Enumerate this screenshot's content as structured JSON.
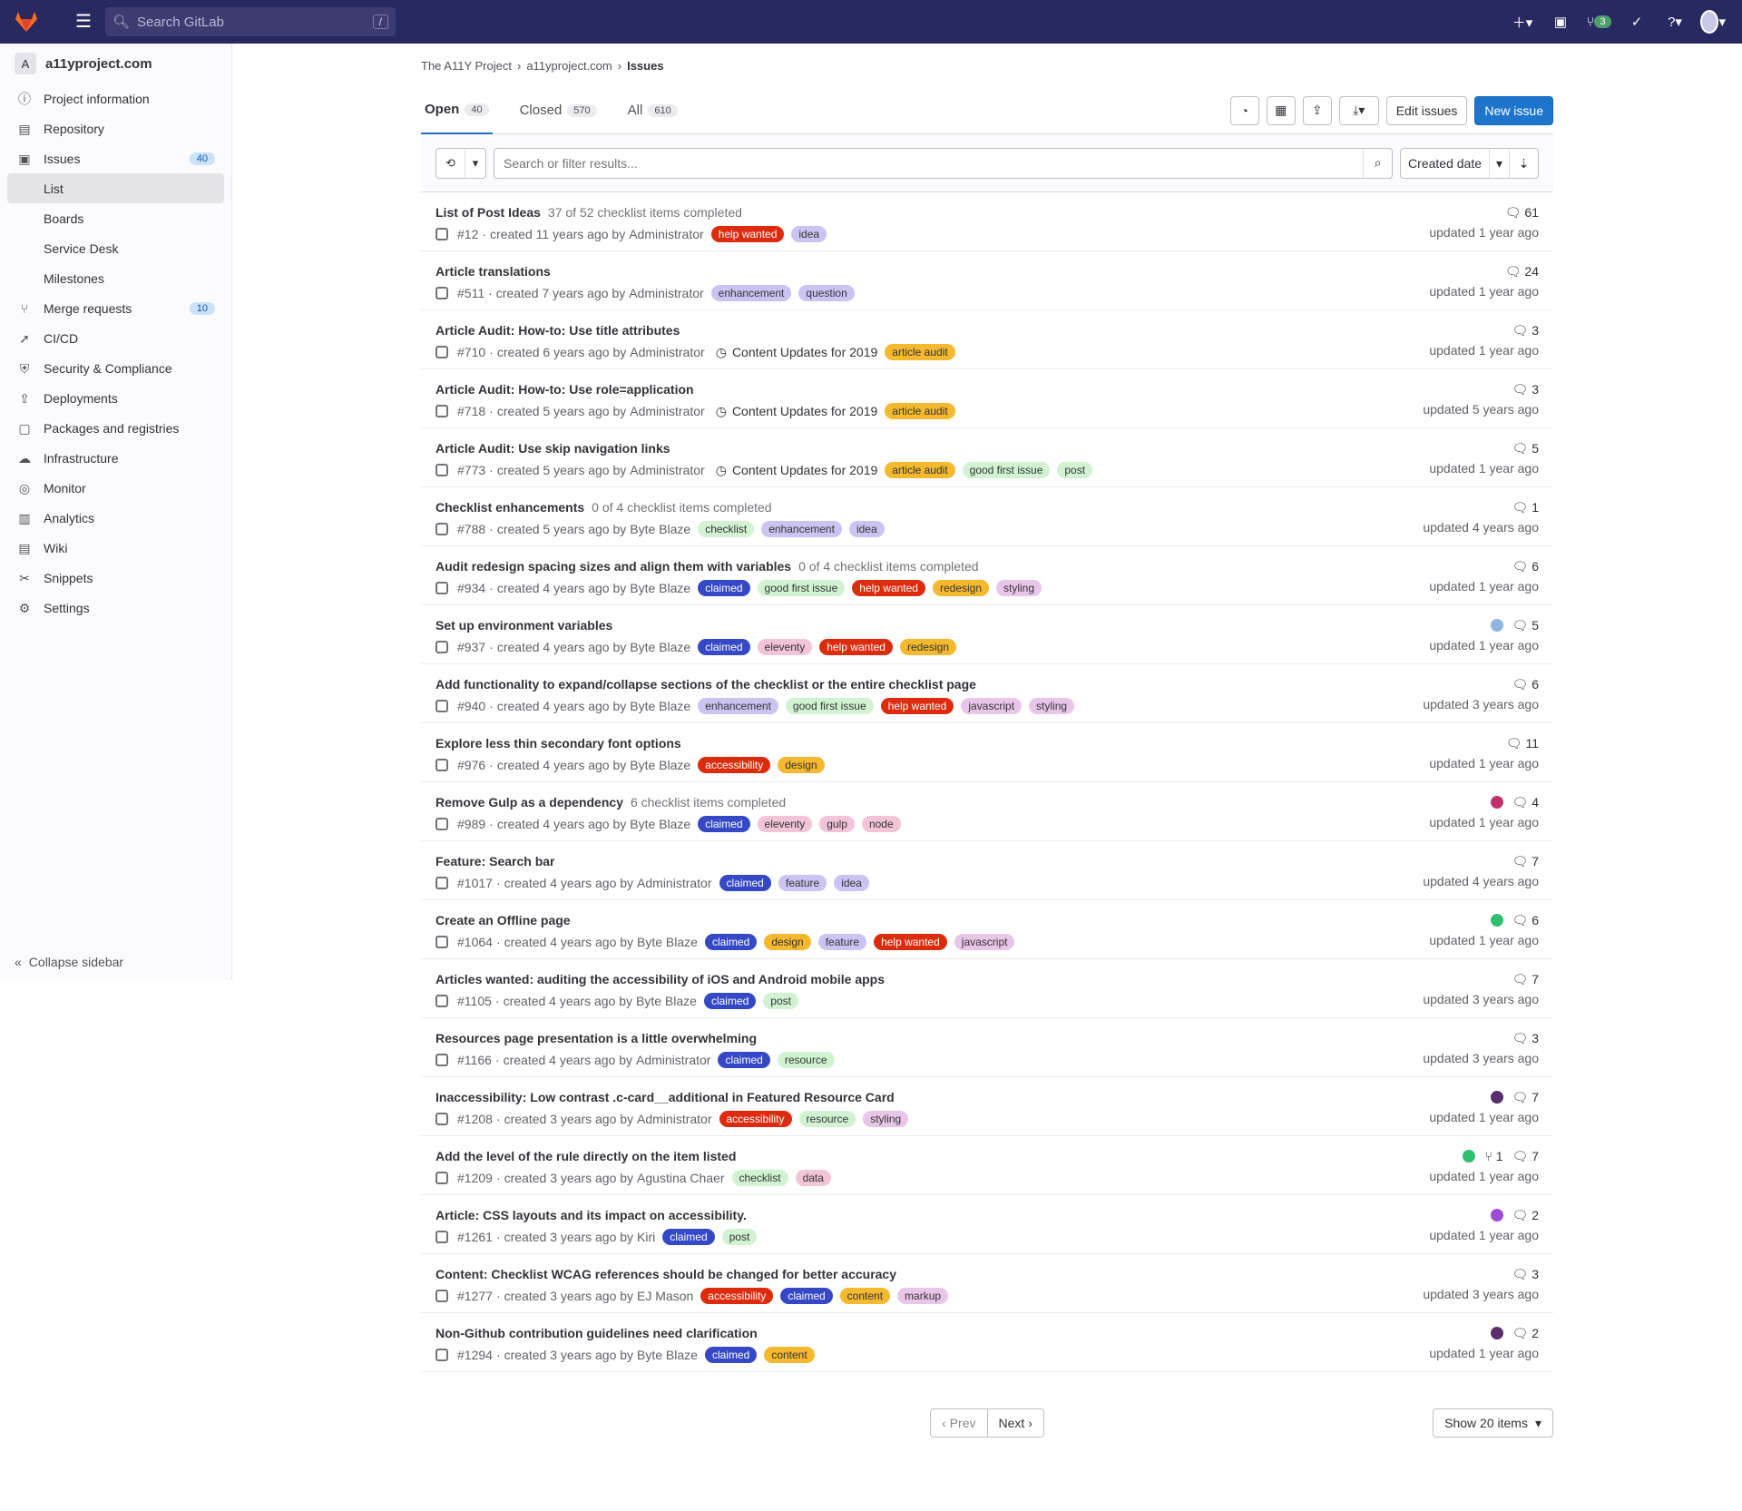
{
  "topbar": {
    "search_placeholder": "Search GitLab",
    "search_shortcut": "/",
    "mr_count": "3"
  },
  "sidebar": {
    "project_initial": "A",
    "project_name": "a11yproject.com",
    "items": [
      {
        "label": "Project information",
        "icon": "info-icon"
      },
      {
        "label": "Repository",
        "icon": "book-icon"
      },
      {
        "label": "Issues",
        "icon": "issues-icon",
        "count": "40"
      },
      {
        "label": "Merge requests",
        "icon": "merge-icon",
        "count": "10"
      },
      {
        "label": "CI/CD",
        "icon": "rocket-icon"
      },
      {
        "label": "Security & Compliance",
        "icon": "shield-icon"
      },
      {
        "label": "Deployments",
        "icon": "deploy-icon"
      },
      {
        "label": "Packages and registries",
        "icon": "package-icon"
      },
      {
        "label": "Infrastructure",
        "icon": "cloud-icon"
      },
      {
        "label": "Monitor",
        "icon": "monitor-icon"
      },
      {
        "label": "Analytics",
        "icon": "chart-icon"
      },
      {
        "label": "Wiki",
        "icon": "wiki-icon"
      },
      {
        "label": "Snippets",
        "icon": "snippet-icon"
      },
      {
        "label": "Settings",
        "icon": "gear-icon"
      }
    ],
    "issue_subitems": [
      "List",
      "Boards",
      "Service Desk",
      "Milestones"
    ],
    "collapse_label": "Collapse sidebar"
  },
  "breadcrumb": [
    "The A11Y Project",
    "a11yproject.com",
    "Issues"
  ],
  "tabs": [
    {
      "label": "Open",
      "count": "40"
    },
    {
      "label": "Closed",
      "count": "570"
    },
    {
      "label": "All",
      "count": "610"
    }
  ],
  "actions": {
    "edit_issues": "Edit issues",
    "new_issue": "New issue"
  },
  "filter": {
    "placeholder": "Search or filter results...",
    "sort_label": "Created date"
  },
  "issues": [
    {
      "title": "List of Post Ideas",
      "tasks": "37 of 52 checklist items completed",
      "num": "#12",
      "created": "created 11 years ago by",
      "author": "Administrator",
      "milestone": "",
      "labels": [
        {
          "t": "help wanted",
          "bg": "#dd2b0e",
          "fg": "#fff"
        },
        {
          "t": "idea",
          "bg": "#cbc3f2",
          "fg": "#333"
        }
      ],
      "comments": "61",
      "updated": "updated 1 year ago"
    },
    {
      "title": "Article translations",
      "tasks": "",
      "num": "#511",
      "created": "created 7 years ago by",
      "author": "Administrator",
      "milestone": "",
      "labels": [
        {
          "t": "enhancement",
          "bg": "#cbc3f2",
          "fg": "#333"
        },
        {
          "t": "question",
          "bg": "#cbc3f2",
          "fg": "#333"
        }
      ],
      "comments": "24",
      "updated": "updated 1 year ago"
    },
    {
      "title": "Article Audit: How-to: Use title attributes",
      "tasks": "",
      "num": "#710",
      "created": "created 6 years ago by",
      "author": "Administrator",
      "milestone": "Content Updates for 2019",
      "labels": [
        {
          "t": "article audit",
          "bg": "#f5b92f",
          "fg": "#333"
        }
      ],
      "comments": "3",
      "updated": "updated 1 year ago"
    },
    {
      "title": "Article Audit: How-to: Use role=application",
      "tasks": "",
      "num": "#718",
      "created": "created 5 years ago by",
      "author": "Administrator",
      "milestone": "Content Updates for 2019",
      "labels": [
        {
          "t": "article audit",
          "bg": "#f5b92f",
          "fg": "#333"
        }
      ],
      "comments": "3",
      "updated": "updated 5 years ago"
    },
    {
      "title": "Article Audit: Use skip navigation links",
      "tasks": "",
      "num": "#773",
      "created": "created 5 years ago by",
      "author": "Administrator",
      "milestone": "Content Updates for 2019",
      "labels": [
        {
          "t": "article audit",
          "bg": "#f5b92f",
          "fg": "#333"
        },
        {
          "t": "good first issue",
          "bg": "#d1f3d1",
          "fg": "#333"
        },
        {
          "t": "post",
          "bg": "#d1f3d1",
          "fg": "#333"
        }
      ],
      "comments": "5",
      "updated": "updated 1 year ago"
    },
    {
      "title": "Checklist enhancements",
      "tasks": "0 of 4 checklist items completed",
      "num": "#788",
      "created": "created 5 years ago by",
      "author": "Byte Blaze",
      "milestone": "",
      "labels": [
        {
          "t": "checklist",
          "bg": "#d1f3d1",
          "fg": "#333"
        },
        {
          "t": "enhancement",
          "bg": "#cbc3f2",
          "fg": "#333"
        },
        {
          "t": "idea",
          "bg": "#cbc3f2",
          "fg": "#333"
        }
      ],
      "comments": "1",
      "updated": "updated 4 years ago"
    },
    {
      "title": "Audit redesign spacing sizes and align them with variables",
      "tasks": "0 of 4 checklist items completed",
      "num": "#934",
      "created": "created 4 years ago by",
      "author": "Byte Blaze",
      "milestone": "",
      "labels": [
        {
          "t": "claimed",
          "bg": "#3548c6",
          "fg": "#fff"
        },
        {
          "t": "good first issue",
          "bg": "#d1f3d1",
          "fg": "#333"
        },
        {
          "t": "help wanted",
          "bg": "#dd2b0e",
          "fg": "#fff"
        },
        {
          "t": "redesign",
          "bg": "#f5b92f",
          "fg": "#333"
        },
        {
          "t": "styling",
          "bg": "#e9c6e9",
          "fg": "#333"
        }
      ],
      "comments": "6",
      "updated": "updated 1 year ago"
    },
    {
      "title": "Set up environment variables",
      "tasks": "",
      "num": "#937",
      "created": "created 4 years ago by",
      "author": "Byte Blaze",
      "milestone": "",
      "labels": [
        {
          "t": "claimed",
          "bg": "#3548c6",
          "fg": "#fff"
        },
        {
          "t": "eleventy",
          "bg": "#f2c4d8",
          "fg": "#333"
        },
        {
          "t": "help wanted",
          "bg": "#dd2b0e",
          "fg": "#fff"
        },
        {
          "t": "redesign",
          "bg": "#f5b92f",
          "fg": "#333"
        }
      ],
      "comments": "5",
      "updated": "updated 1 year ago",
      "avatar": "#8fb4e0"
    },
    {
      "title": "Add functionality to expand/collapse sections of the checklist or the entire checklist page",
      "tasks": "",
      "num": "#940",
      "created": "created 4 years ago by",
      "author": "Byte Blaze",
      "milestone": "",
      "labels": [
        {
          "t": "enhancement",
          "bg": "#cbc3f2",
          "fg": "#333"
        },
        {
          "t": "good first issue",
          "bg": "#d1f3d1",
          "fg": "#333"
        },
        {
          "t": "help wanted",
          "bg": "#dd2b0e",
          "fg": "#fff"
        },
        {
          "t": "javascript",
          "bg": "#e9c6e9",
          "fg": "#333"
        },
        {
          "t": "styling",
          "bg": "#e9c6e9",
          "fg": "#333"
        }
      ],
      "comments": "6",
      "updated": "updated 3 years ago"
    },
    {
      "title": "Explore less thin secondary font options",
      "tasks": "",
      "num": "#976",
      "created": "created 4 years ago by",
      "author": "Byte Blaze",
      "milestone": "",
      "labels": [
        {
          "t": "accessibility",
          "bg": "#dd2b0e",
          "fg": "#fff"
        },
        {
          "t": "design",
          "bg": "#f5b92f",
          "fg": "#333"
        }
      ],
      "comments": "11",
      "updated": "updated 1 year ago"
    },
    {
      "title": "Remove Gulp as a dependency",
      "tasks": "6 checklist items completed",
      "num": "#989",
      "created": "created 4 years ago by",
      "author": "Byte Blaze",
      "milestone": "",
      "labels": [
        {
          "t": "claimed",
          "bg": "#3548c6",
          "fg": "#fff"
        },
        {
          "t": "eleventy",
          "bg": "#f2c4d8",
          "fg": "#333"
        },
        {
          "t": "gulp",
          "bg": "#f2c4d8",
          "fg": "#333"
        },
        {
          "t": "node",
          "bg": "#f2c4d8",
          "fg": "#333"
        }
      ],
      "comments": "4",
      "updated": "updated 1 year ago",
      "avatar": "#c0306a"
    },
    {
      "title": "Feature: Search bar",
      "tasks": "",
      "num": "#1017",
      "created": "created 4 years ago by",
      "author": "Administrator",
      "milestone": "",
      "labels": [
        {
          "t": "claimed",
          "bg": "#3548c6",
          "fg": "#fff"
        },
        {
          "t": "feature",
          "bg": "#cbc3f2",
          "fg": "#333"
        },
        {
          "t": "idea",
          "bg": "#cbc3f2",
          "fg": "#333"
        }
      ],
      "comments": "7",
      "updated": "updated 4 years ago"
    },
    {
      "title": "Create an Offline page",
      "tasks": "",
      "num": "#1064",
      "created": "created 4 years ago by",
      "author": "Byte Blaze",
      "milestone": "",
      "labels": [
        {
          "t": "claimed",
          "bg": "#3548c6",
          "fg": "#fff"
        },
        {
          "t": "design",
          "bg": "#f5b92f",
          "fg": "#333"
        },
        {
          "t": "feature",
          "bg": "#cbc3f2",
          "fg": "#333"
        },
        {
          "t": "help wanted",
          "bg": "#dd2b0e",
          "fg": "#fff"
        },
        {
          "t": "javascript",
          "bg": "#e9c6e9",
          "fg": "#333"
        }
      ],
      "comments": "6",
      "updated": "updated 1 year ago",
      "avatar": "#2fbf71"
    },
    {
      "title": "Articles wanted: auditing the accessibility of iOS and Android mobile apps",
      "tasks": "",
      "num": "#1105",
      "created": "created 4 years ago by",
      "author": "Byte Blaze",
      "milestone": "",
      "labels": [
        {
          "t": "claimed",
          "bg": "#3548c6",
          "fg": "#fff"
        },
        {
          "t": "post",
          "bg": "#d1f3d1",
          "fg": "#333"
        }
      ],
      "comments": "7",
      "updated": "updated 3 years ago"
    },
    {
      "title": "Resources page presentation is a little overwhelming",
      "tasks": "",
      "num": "#1166",
      "created": "created 4 years ago by",
      "author": "Administrator",
      "milestone": "",
      "labels": [
        {
          "t": "claimed",
          "bg": "#3548c6",
          "fg": "#fff"
        },
        {
          "t": "resource",
          "bg": "#d1f3d1",
          "fg": "#333"
        }
      ],
      "comments": "3",
      "updated": "updated 3 years ago"
    },
    {
      "title": "Inaccessibility: Low contrast .c-card__additional in Featured Resource Card",
      "tasks": "",
      "num": "#1208",
      "created": "created 3 years ago by",
      "author": "Administrator",
      "milestone": "",
      "labels": [
        {
          "t": "accessibility",
          "bg": "#dd2b0e",
          "fg": "#fff"
        },
        {
          "t": "resource",
          "bg": "#d1f3d1",
          "fg": "#333"
        },
        {
          "t": "styling",
          "bg": "#e9c6e9",
          "fg": "#333"
        }
      ],
      "comments": "7",
      "updated": "updated 1 year ago",
      "avatar": "#5a2d6e"
    },
    {
      "title": "Add the level of the rule directly on the item listed",
      "tasks": "",
      "num": "#1209",
      "created": "created 3 years ago by",
      "author": "Agustina Chaer",
      "milestone": "",
      "labels": [
        {
          "t": "checklist",
          "bg": "#d1f3d1",
          "fg": "#333"
        },
        {
          "t": "data",
          "bg": "#f2c4d8",
          "fg": "#333"
        }
      ],
      "comments": "7",
      "mrs": "1",
      "updated": "updated 1 year ago",
      "avatar": "#2fbf71"
    },
    {
      "title": "Article: CSS layouts and its impact on accessibility.",
      "tasks": "",
      "num": "#1261",
      "created": "created 3 years ago by",
      "author": "Kiri",
      "milestone": "",
      "labels": [
        {
          "t": "claimed",
          "bg": "#3548c6",
          "fg": "#fff"
        },
        {
          "t": "post",
          "bg": "#d1f3d1",
          "fg": "#333"
        }
      ],
      "comments": "2",
      "updated": "updated 1 year ago",
      "avatar": "#a04ad8"
    },
    {
      "title": "Content: Checklist WCAG references should be changed for better accuracy",
      "tasks": "",
      "num": "#1277",
      "created": "created 3 years ago by",
      "author": "EJ Mason",
      "milestone": "",
      "labels": [
        {
          "t": "accessibility",
          "bg": "#dd2b0e",
          "fg": "#fff"
        },
        {
          "t": "claimed",
          "bg": "#3548c6",
          "fg": "#fff"
        },
        {
          "t": "content",
          "bg": "#f5b92f",
          "fg": "#333"
        },
        {
          "t": "markup",
          "bg": "#e9c6e9",
          "fg": "#333"
        }
      ],
      "comments": "3",
      "updated": "updated 3 years ago"
    },
    {
      "title": "Non-Github contribution guidelines need clarification",
      "tasks": "",
      "num": "#1294",
      "created": "created 3 years ago by",
      "author": "Byte Blaze",
      "milestone": "",
      "labels": [
        {
          "t": "claimed",
          "bg": "#3548c6",
          "fg": "#fff"
        },
        {
          "t": "content",
          "bg": "#f5b92f",
          "fg": "#333"
        }
      ],
      "comments": "2",
      "updated": "updated 1 year ago",
      "avatar": "#5a2d6e"
    }
  ],
  "pagination": {
    "prev": "Prev",
    "next": "Next",
    "show": "Show 20 items"
  }
}
